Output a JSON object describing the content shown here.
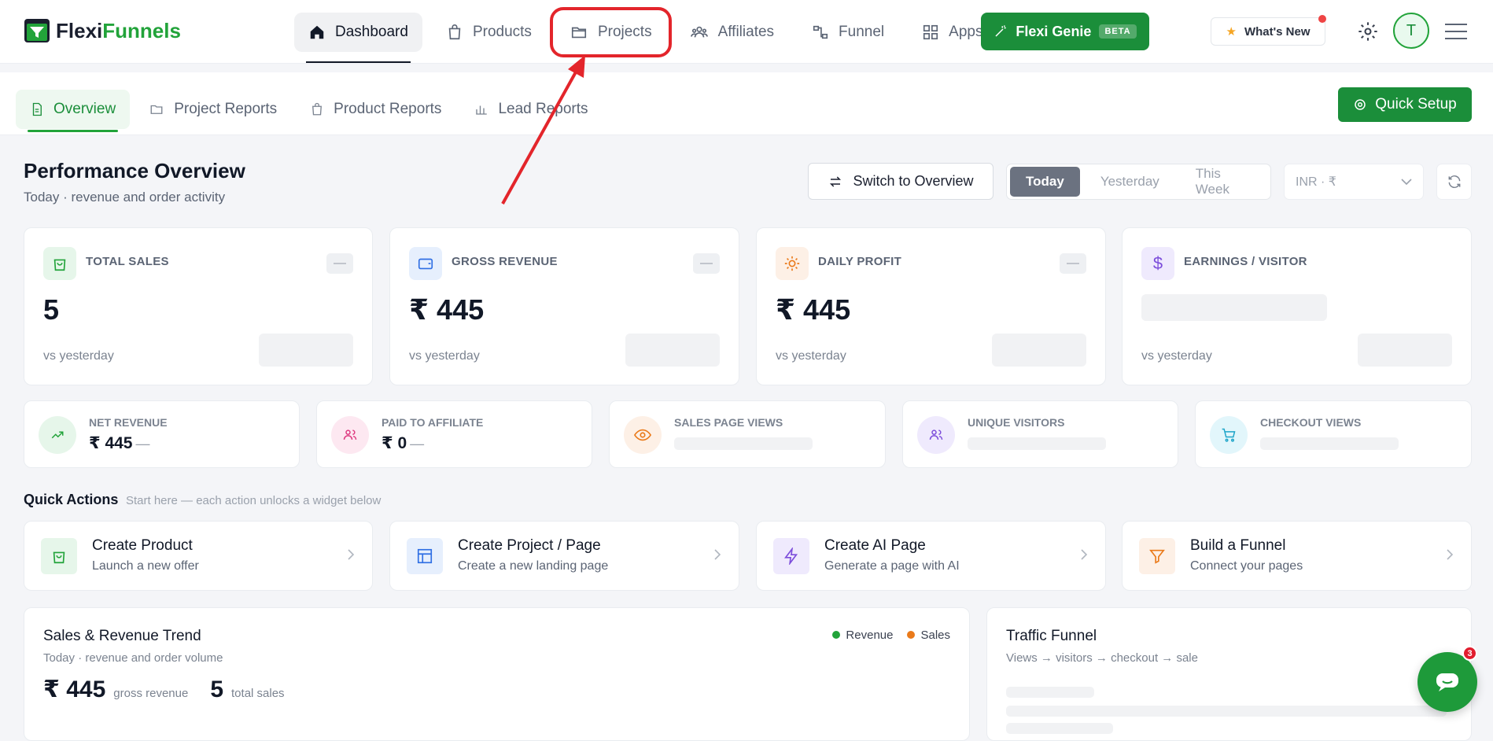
{
  "brand": {
    "part1": "Flexi",
    "part2": "Funnels"
  },
  "nav": [
    {
      "label": "Dashboard",
      "icon": "home-icon"
    },
    {
      "label": "Products",
      "icon": "shopping-bag-icon"
    },
    {
      "label": "Projects",
      "icon": "folder-icon"
    },
    {
      "label": "Affiliates",
      "icon": "users-icon"
    },
    {
      "label": "Funnel",
      "icon": "funnel-icon"
    },
    {
      "label": "Apps",
      "icon": "grid-icon"
    }
  ],
  "genie": {
    "label": "Flexi Genie",
    "badge": "BETA"
  },
  "whats_new": "What's New",
  "avatar_initial": "T",
  "subtabs": [
    {
      "label": "Overview",
      "icon": "document-icon"
    },
    {
      "label": "Project Reports",
      "icon": "folder-icon"
    },
    {
      "label": "Product Reports",
      "icon": "bag-icon"
    },
    {
      "label": "Lead Reports",
      "icon": "bar-chart-icon"
    }
  ],
  "quick_setup": "Quick Setup",
  "header": {
    "title": "Performance Overview",
    "subtitle": "Today · revenue and order activity",
    "switch_label": "Switch to Overview",
    "ranges": [
      "Today",
      "Yesterday",
      "This Week"
    ],
    "currency": "INR · ₹"
  },
  "stats": [
    {
      "label": "TOTAL SALES",
      "value": "5",
      "vs": "vs yesterday",
      "dash": "—"
    },
    {
      "label": "GROSS REVENUE",
      "value": "₹ 445",
      "vs": "vs yesterday",
      "dash": "—"
    },
    {
      "label": "DAILY PROFIT",
      "value": "₹ 445",
      "vs": "vs yesterday",
      "dash": "—"
    },
    {
      "label": "EARNINGS / VISITOR",
      "value": "",
      "vs": "vs yesterday",
      "dash": ""
    }
  ],
  "mini": [
    {
      "label": "NET REVENUE",
      "value": "₹ 445",
      "em": "—"
    },
    {
      "label": "PAID TO AFFILIATE",
      "value": "₹ 0",
      "em": "—"
    },
    {
      "label": "SALES PAGE VIEWS"
    },
    {
      "label": "UNIQUE VISITORS"
    },
    {
      "label": "CHECKOUT VIEWS"
    }
  ],
  "quick_actions": {
    "title": "Quick Actions",
    "subtitle": "Start here — each action unlocks a widget below",
    "items": [
      {
        "title": "Create Product",
        "sub": "Launch a new offer"
      },
      {
        "title": "Create Project / Page",
        "sub": "Create a new landing page"
      },
      {
        "title": "Create AI Page",
        "sub": "Generate a page with AI"
      },
      {
        "title": "Build a Funnel",
        "sub": "Connect your pages"
      }
    ]
  },
  "trend": {
    "title": "Sales & Revenue Trend",
    "subtitle": "Today · revenue and order volume",
    "legend": [
      "Revenue",
      "Sales"
    ],
    "gross_value": "₹ 445",
    "gross_label": "gross revenue",
    "sales_value": "5",
    "sales_label": "total sales"
  },
  "traffic": {
    "title": "Traffic Funnel",
    "subtitle": "Views → visitors → checkout → sale"
  },
  "chat_badge": "3",
  "colors": {
    "brand_green": "#1b8e3a",
    "highlight_red": "#e3252b"
  }
}
